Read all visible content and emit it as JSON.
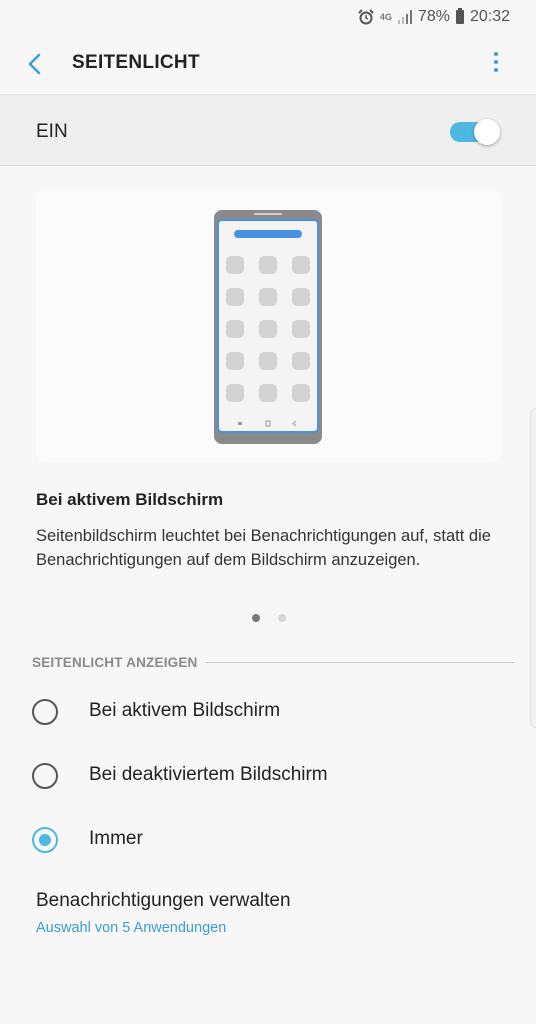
{
  "status_bar": {
    "network": "4G",
    "battery": "78%",
    "time": "20:32",
    "icons": [
      "alarm-icon",
      "signal-icon",
      "battery-icon"
    ]
  },
  "app_bar": {
    "title": "SEITENLICHT",
    "back_icon": "chevron-left-icon",
    "more_icon": "more-vertical-icon"
  },
  "master_switch": {
    "label": "EIN",
    "on": true
  },
  "illustration": {
    "title": "Bei aktivem Bildschirm",
    "description": "Seitenbildschirm leuchtet bei Benachrichtigungen auf, statt die Benachrichtigungen auf dem Bildschirm anzuzeigen.",
    "pages": 2,
    "active_page": 1
  },
  "section": {
    "header": "SEITENLICHT ANZEIGEN",
    "options": [
      {
        "label": "Bei aktivem Bildschirm",
        "checked": false
      },
      {
        "label": "Bei deaktiviertem Bildschirm",
        "checked": false
      },
      {
        "label": "Immer",
        "checked": true
      }
    ]
  },
  "manage": {
    "title": "Benachrichtigungen verwalten",
    "subtitle": "Auswahl von 5 Anwendungen"
  },
  "colors": {
    "accent": "#4fb8e0",
    "link": "#3f9bd4",
    "background": "#f7f7f7"
  }
}
